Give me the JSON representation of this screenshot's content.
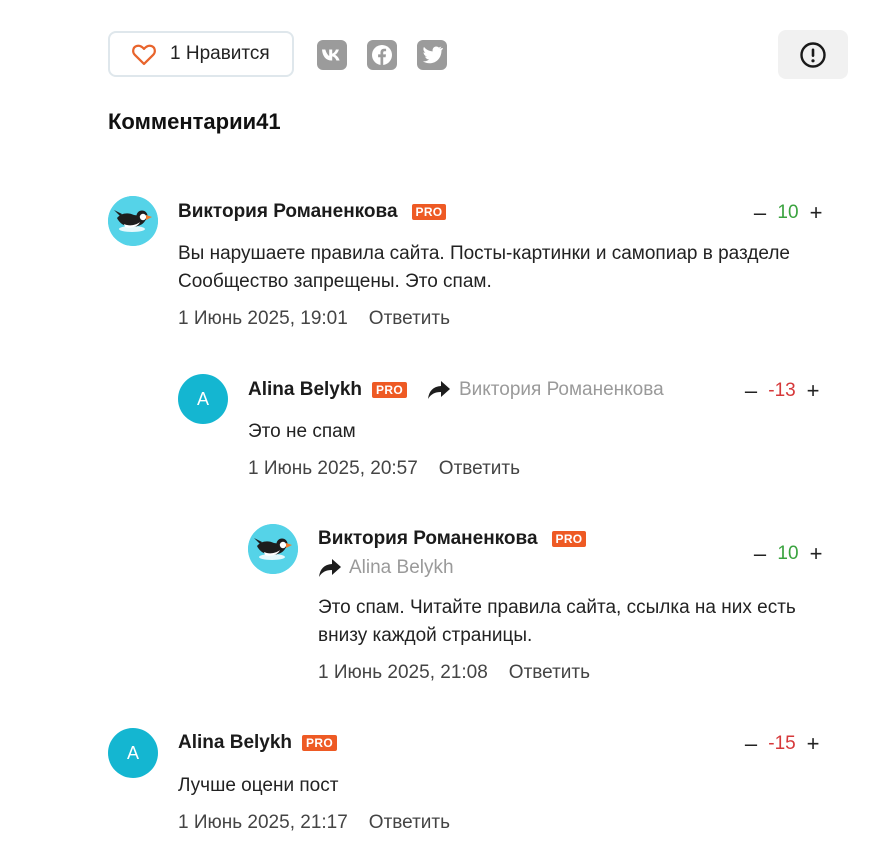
{
  "actions": {
    "like_label": "1 Нравится",
    "share_icons": [
      "vk-icon",
      "facebook-icon",
      "twitter-icon"
    ],
    "report_icon": "exclamation-circle-icon"
  },
  "comments_header": {
    "title": "Комментарии41"
  },
  "colors": {
    "accent": "#ee5a24",
    "positive": "#3aa33f",
    "negative": "#d6383a",
    "avatar_bg": "#14b6d1"
  },
  "comments": [
    {
      "author": "Виктория Романенкова",
      "badge": "PRO",
      "avatar": "puffin-avatar",
      "text": "Вы нарушаете правила сайта. Посты-картинки и самопиар в разделе Сообщество запрещены. Это спам.",
      "date": "1 Июнь 2025, 19:01",
      "reply_label": "Ответить",
      "score": "10"
    },
    {
      "author": "Alina Belykh",
      "badge": "PRO",
      "avatar_letter": "A",
      "reply_to": "Виктория Романенкова",
      "text": "Это не спам",
      "date": "1 Июнь 2025, 20:57",
      "reply_label": "Ответить",
      "score": "-13"
    },
    {
      "author": "Виктория Романенкова",
      "badge": "PRO",
      "avatar": "puffin-avatar",
      "reply_to": "Alina Belykh",
      "text": "Это спам. Читайте правила сайта, ссылка на них есть внизу каждой страницы.",
      "date": "1 Июнь 2025, 21:08",
      "reply_label": "Ответить",
      "score": "10"
    },
    {
      "author": "Alina Belykh",
      "badge": "PRO",
      "avatar_letter": "A",
      "text": "Лучше оцени пост",
      "date": "1 Июнь 2025, 21:17",
      "reply_label": "Ответить",
      "score": "-15"
    }
  ],
  "vote": {
    "minus": "–",
    "plus": "+"
  }
}
